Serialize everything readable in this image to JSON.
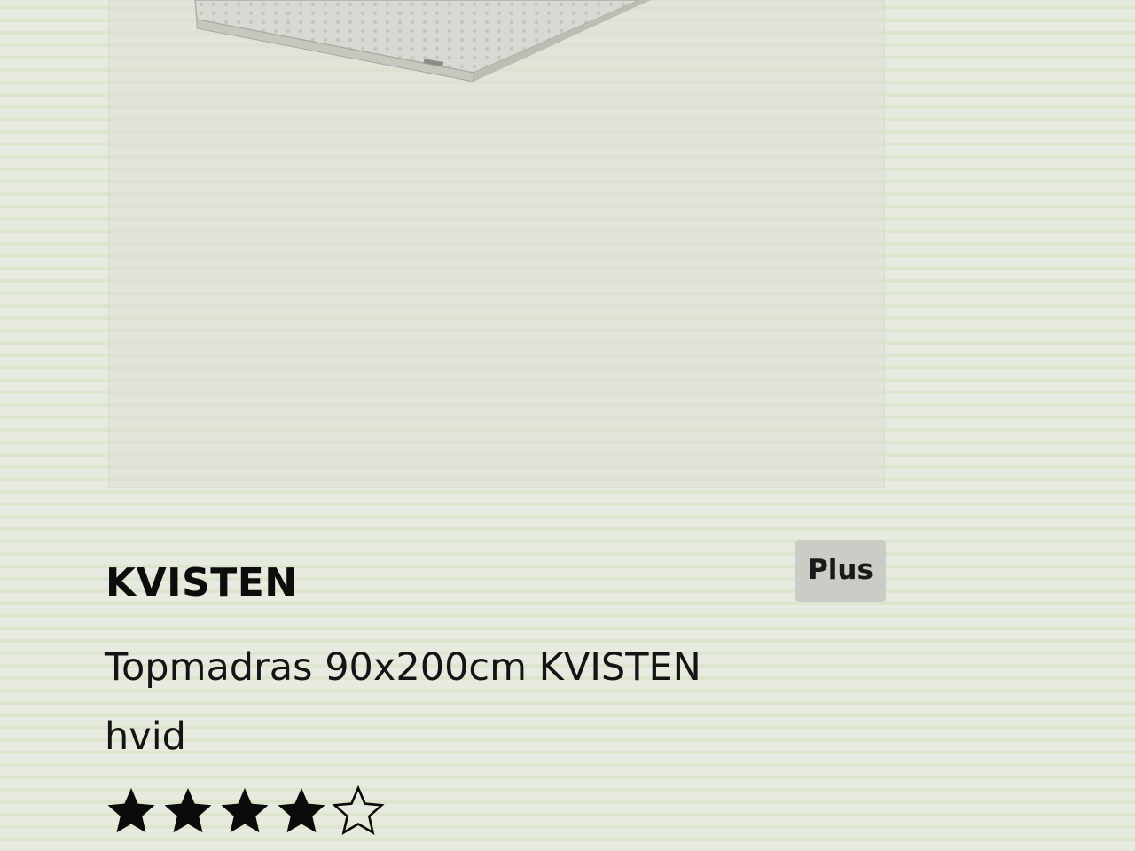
{
  "product": {
    "badge": "Plus",
    "brand": "KVISTEN",
    "description_line1": "Topmadras 90x200cm KVISTEN",
    "description_line2": "hvid",
    "rating": {
      "value": 4,
      "max": 5
    }
  },
  "icons": {
    "image": "mattress-topper-image",
    "star_filled": "star-filled-icon",
    "star_empty": "star-outline-icon"
  },
  "colors": {
    "badge_bg": "#c9cdc6",
    "text": "#111111"
  }
}
